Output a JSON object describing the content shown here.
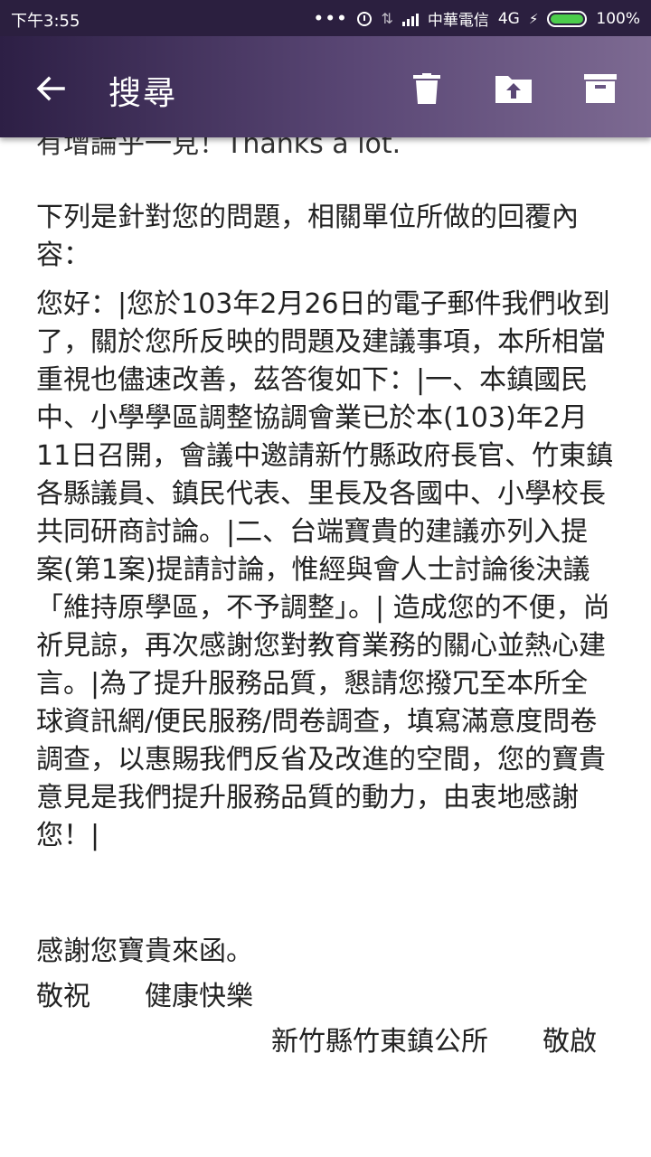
{
  "status_bar": {
    "time": "下午3:55",
    "more_dots": "•••",
    "carrier": "中華電信",
    "network": "4G",
    "battery_percent": "100%",
    "battery_level": 1.0
  },
  "toolbar": {
    "title": "搜尋",
    "icons": [
      "back-arrow-icon",
      "trash-icon",
      "folder-move-icon",
      "archive-icon"
    ]
  },
  "message": {
    "cut_line": "有增論乎一見！Thanks a lot.",
    "intro": "下列是針對您的問題，相關單位所做的回覆內容：",
    "reply": "您好：|您於103年2月26日的電子郵件我們收到了，關於您所反映的問題及建議事項，本所相當重視也儘速改善，茲答復如下：|一、本鎮國民中、小學學區調整協調會業已於本(103)年2月11日召開，會議中邀請新竹縣政府長官、竹東鎮各縣議員、鎮民代表、里長及各國中、小學校長共同研商討論。|二、台端寶貴的建議亦列入提案(第1案)提請討論，惟經與會人士討論後決議「維持原學區，不予調整」。| 造成您的不便，尚祈見諒，再次感謝您對教育業務的關心並熱心建言。|為了提升服務品質，懇請您撥冗至本所全球資訊網/便民服務/問卷調查，填寫滿意度問卷調查，以惠賜我們反省及改進的空間，您的寶貴意見是我們提升服務品質的動力，由衷地感謝您！|",
    "thanks": "感謝您寶貴來函。",
    "regards_left": "敬祝",
    "regards_right": "健康快樂",
    "signature_org": "新竹縣竹東鎮公所",
    "signature_closing": "敬啟"
  },
  "colors": {
    "toolbar_start": "#2d1f45",
    "toolbar_end": "#7d6a92",
    "battery_green": "#4ccd4c"
  }
}
